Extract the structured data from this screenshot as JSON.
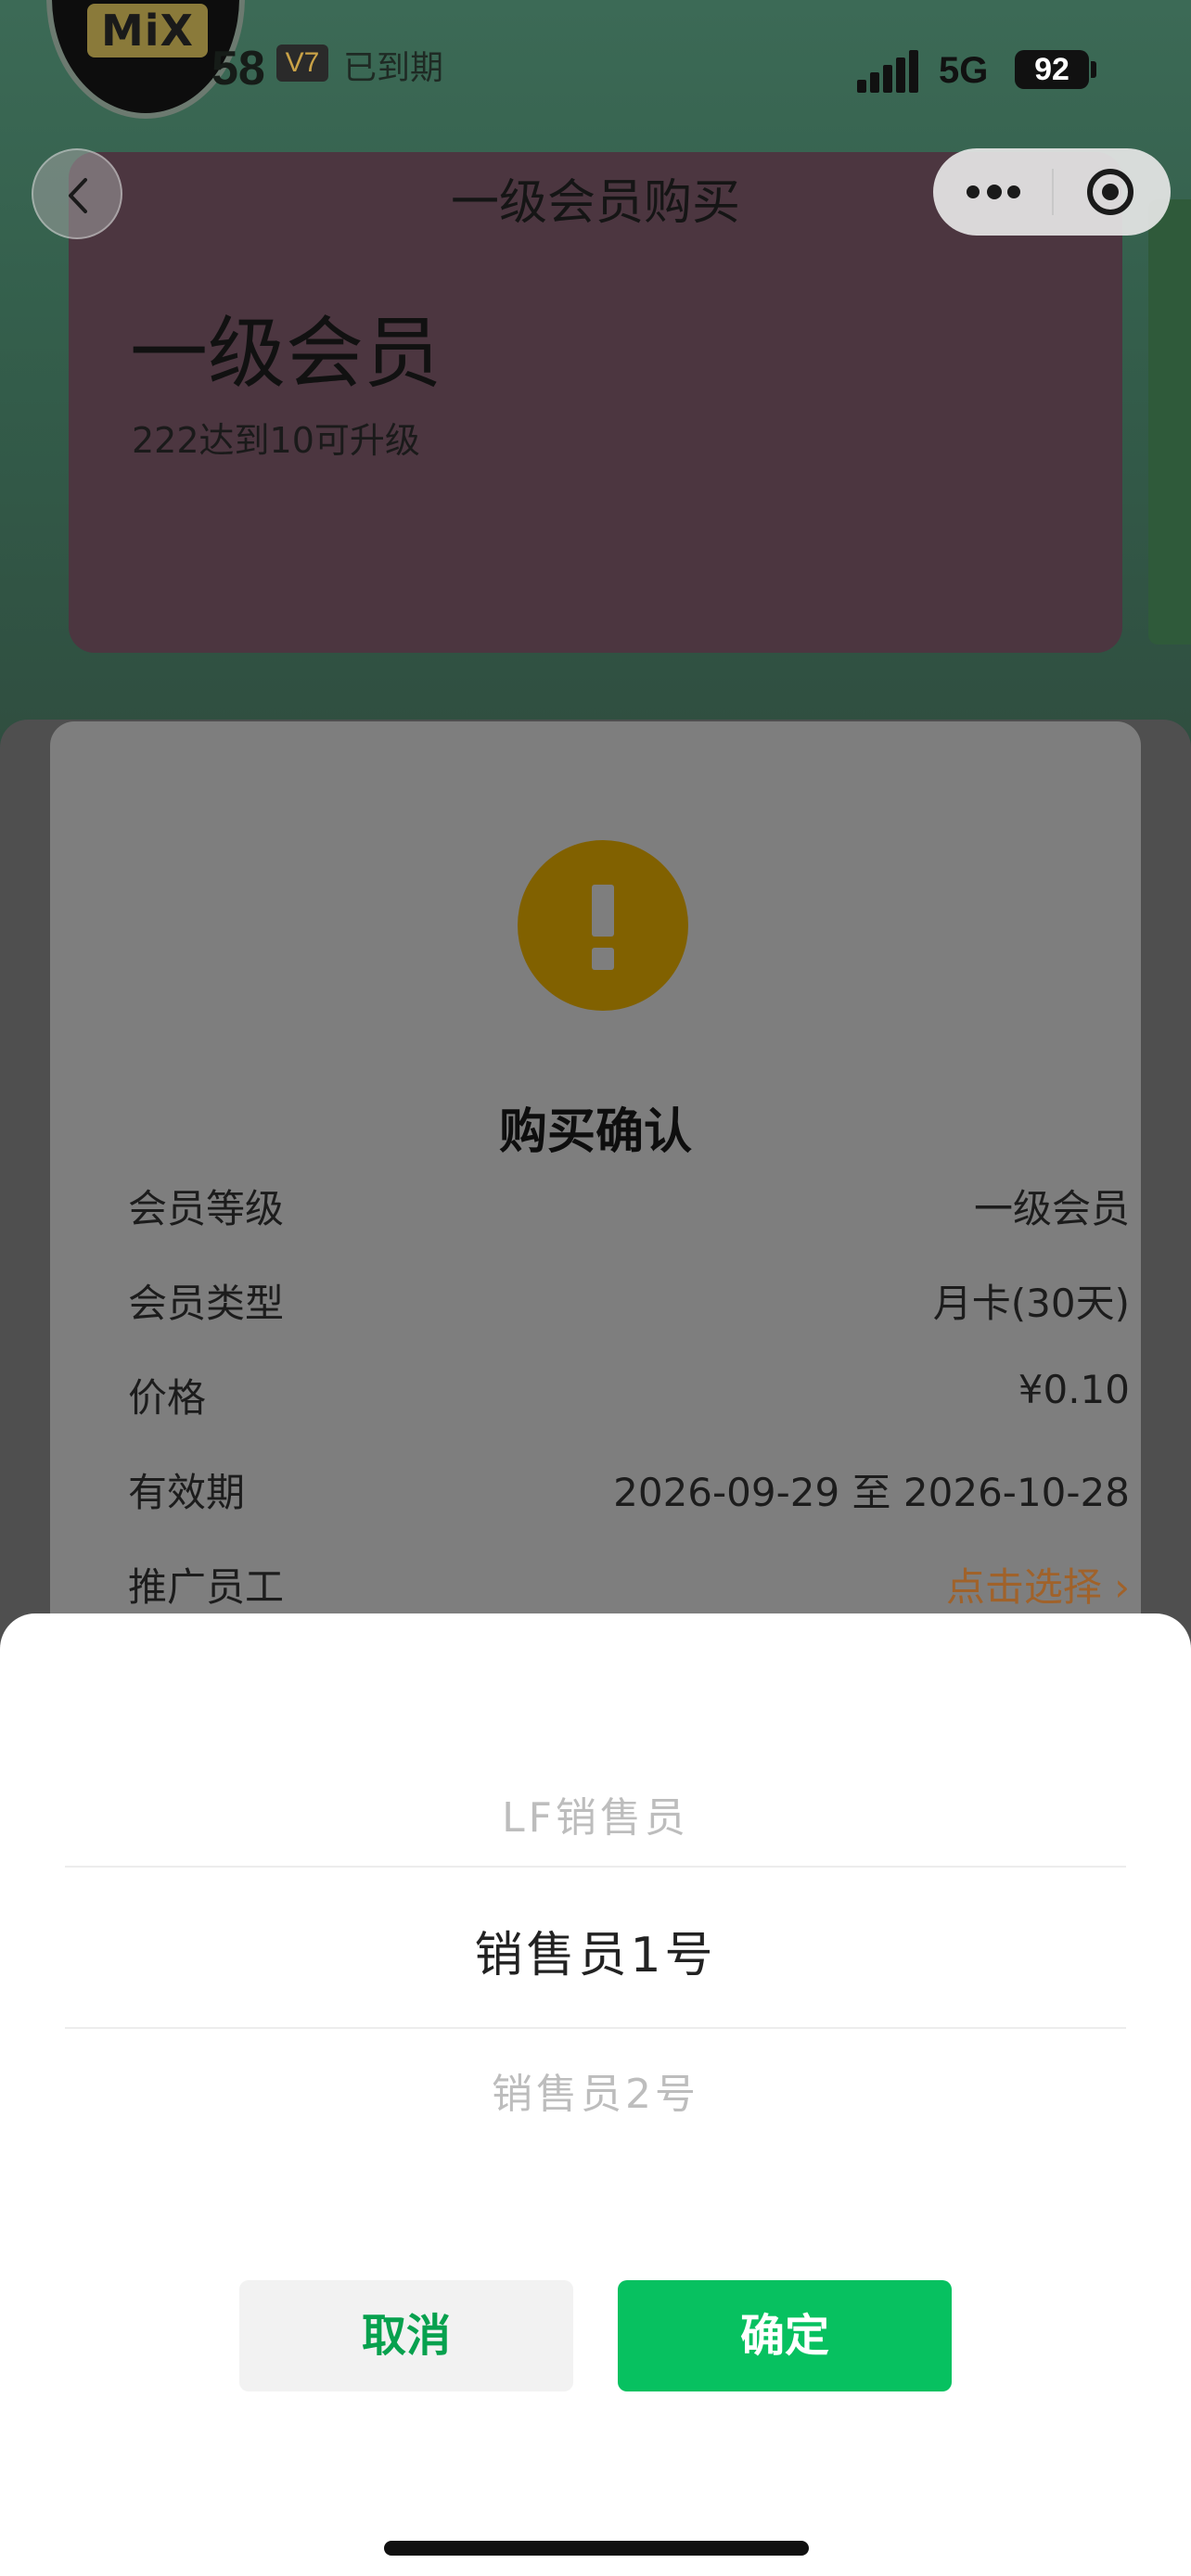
{
  "header": {
    "user_number": "58",
    "vip_badge": "V7",
    "expired_label": "已到期",
    "avatar_logo_text": "MiX"
  },
  "status_bar": {
    "network": "5G",
    "battery": "92"
  },
  "nav": {
    "title": "一级会员购买"
  },
  "member_card": {
    "title": "一级会员",
    "subtitle": "222达到10可升级"
  },
  "confirm": {
    "title": "购买确认",
    "rows": [
      {
        "key": "会员等级",
        "value": "一级会员"
      },
      {
        "key": "会员类型",
        "value": "月卡(30天)"
      },
      {
        "key": "价格",
        "value": "¥0.10"
      },
      {
        "key": "有效期",
        "value": "2026-09-29 至 2026-10-28"
      },
      {
        "key": "推广员工",
        "value": "点击选择 ›"
      }
    ]
  },
  "picker": {
    "ghost_top": "",
    "options": [
      "LF销售员",
      "销售员1号",
      "销售员2号"
    ],
    "selected_index": 1,
    "ghost_bottom": ""
  },
  "actions": {
    "cancel_label": "取消",
    "confirm_label": "确定"
  },
  "colors": {
    "primary_green": "#07c160",
    "accent_orange": "#a0622a",
    "warning_yellow": "#816100"
  }
}
